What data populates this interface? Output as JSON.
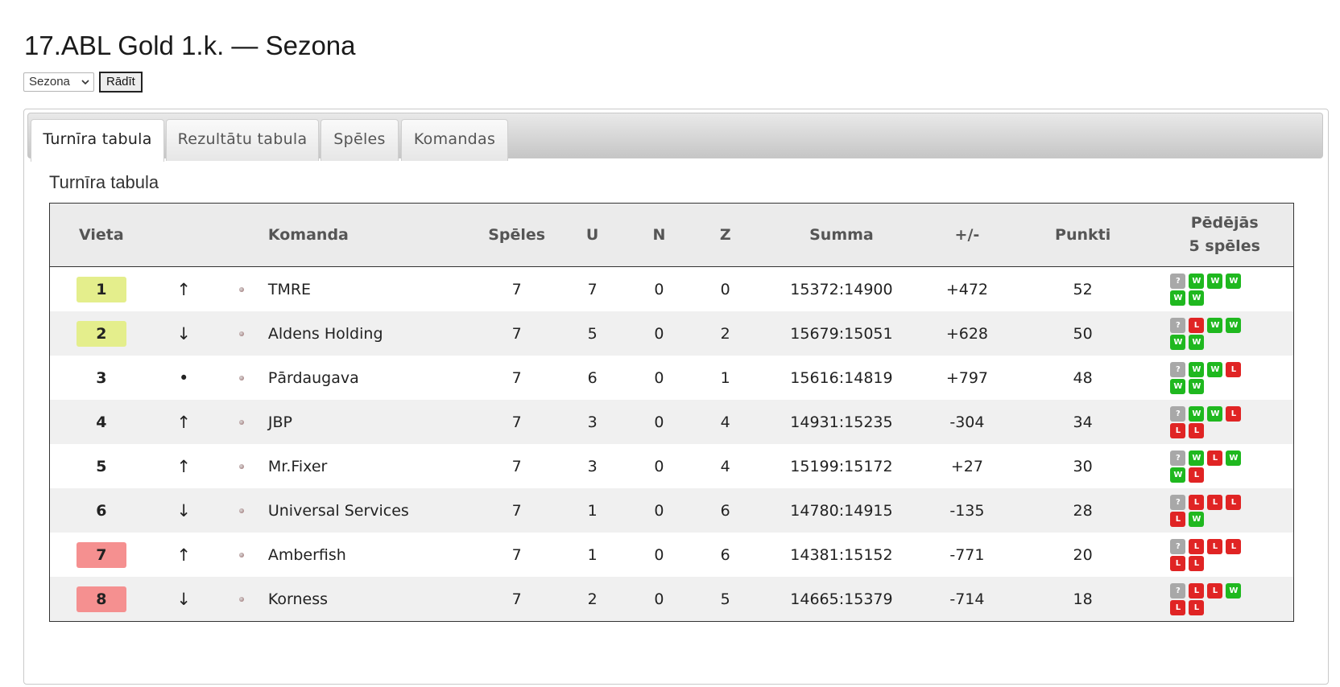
{
  "page": {
    "title": "17.ABL Gold 1.k. — Sezona"
  },
  "season_form": {
    "select_value": "Sezona",
    "button_label": "Rādīt"
  },
  "tabs": [
    {
      "label": "Turnīra tabula",
      "active": true
    },
    {
      "label": "Rezultātu tabula",
      "active": false
    },
    {
      "label": "Spēles",
      "active": false
    },
    {
      "label": "Komandas",
      "active": false
    }
  ],
  "section_title": "Turnīra tabula",
  "table": {
    "headers": {
      "place": "Vieta",
      "team": "Komanda",
      "games": "Spēles",
      "wins": "U",
      "draws": "N",
      "losses": "Z",
      "sum": "Summa",
      "diff": "+/-",
      "points": "Punkti",
      "last5_line1": "Pēdējās",
      "last5_line2": "5 spēles"
    },
    "rows": [
      {
        "place": "1",
        "zone": "promo",
        "trend": "↑",
        "team": "TMRE",
        "games": "7",
        "wins": "7",
        "draws": "0",
        "losses": "0",
        "sum": "15372:14900",
        "diff": "+472",
        "points": "52",
        "form": [
          "?",
          "W",
          "W",
          "W",
          "W",
          "W"
        ]
      },
      {
        "place": "2",
        "zone": "promo",
        "trend": "↓",
        "team": "Aldens Holding",
        "games": "7",
        "wins": "5",
        "draws": "0",
        "losses": "2",
        "sum": "15679:15051",
        "diff": "+628",
        "points": "50",
        "form": [
          "?",
          "L",
          "W",
          "W",
          "W",
          "W"
        ]
      },
      {
        "place": "3",
        "zone": "",
        "trend": "•",
        "team": "Pārdaugava",
        "games": "7",
        "wins": "6",
        "draws": "0",
        "losses": "1",
        "sum": "15616:14819",
        "diff": "+797",
        "points": "48",
        "form": [
          "?",
          "W",
          "W",
          "L",
          "W",
          "W"
        ]
      },
      {
        "place": "4",
        "zone": "",
        "trend": "↑",
        "team": "JBP",
        "games": "7",
        "wins": "3",
        "draws": "0",
        "losses": "4",
        "sum": "14931:15235",
        "diff": "-304",
        "points": "34",
        "form": [
          "?",
          "W",
          "W",
          "L",
          "L",
          "L"
        ]
      },
      {
        "place": "5",
        "zone": "",
        "trend": "↑",
        "team": "Mr.Fixer",
        "games": "7",
        "wins": "3",
        "draws": "0",
        "losses": "4",
        "sum": "15199:15172",
        "diff": "+27",
        "points": "30",
        "form": [
          "?",
          "W",
          "L",
          "W",
          "W",
          "L"
        ]
      },
      {
        "place": "6",
        "zone": "",
        "trend": "↓",
        "team": "Universal Services",
        "games": "7",
        "wins": "1",
        "draws": "0",
        "losses": "6",
        "sum": "14780:14915",
        "diff": "-135",
        "points": "28",
        "form": [
          "?",
          "L",
          "L",
          "L",
          "L",
          "W"
        ]
      },
      {
        "place": "7",
        "zone": "releg",
        "trend": "↑",
        "team": "Amberfish",
        "games": "7",
        "wins": "1",
        "draws": "0",
        "losses": "6",
        "sum": "14381:15152",
        "diff": "-771",
        "points": "20",
        "form": [
          "?",
          "L",
          "L",
          "L",
          "L",
          "L"
        ]
      },
      {
        "place": "8",
        "zone": "releg",
        "trend": "↓",
        "team": "Korness",
        "games": "7",
        "wins": "2",
        "draws": "0",
        "losses": "5",
        "sum": "14665:15379",
        "diff": "-714",
        "points": "18",
        "form": [
          "?",
          "L",
          "L",
          "W",
          "L",
          "L"
        ]
      }
    ]
  },
  "colors": {
    "promo": "#e4ee8c",
    "releg": "#f59090",
    "win": "#1fb81f",
    "loss": "#e02424",
    "unknown": "#a8a8a8"
  }
}
